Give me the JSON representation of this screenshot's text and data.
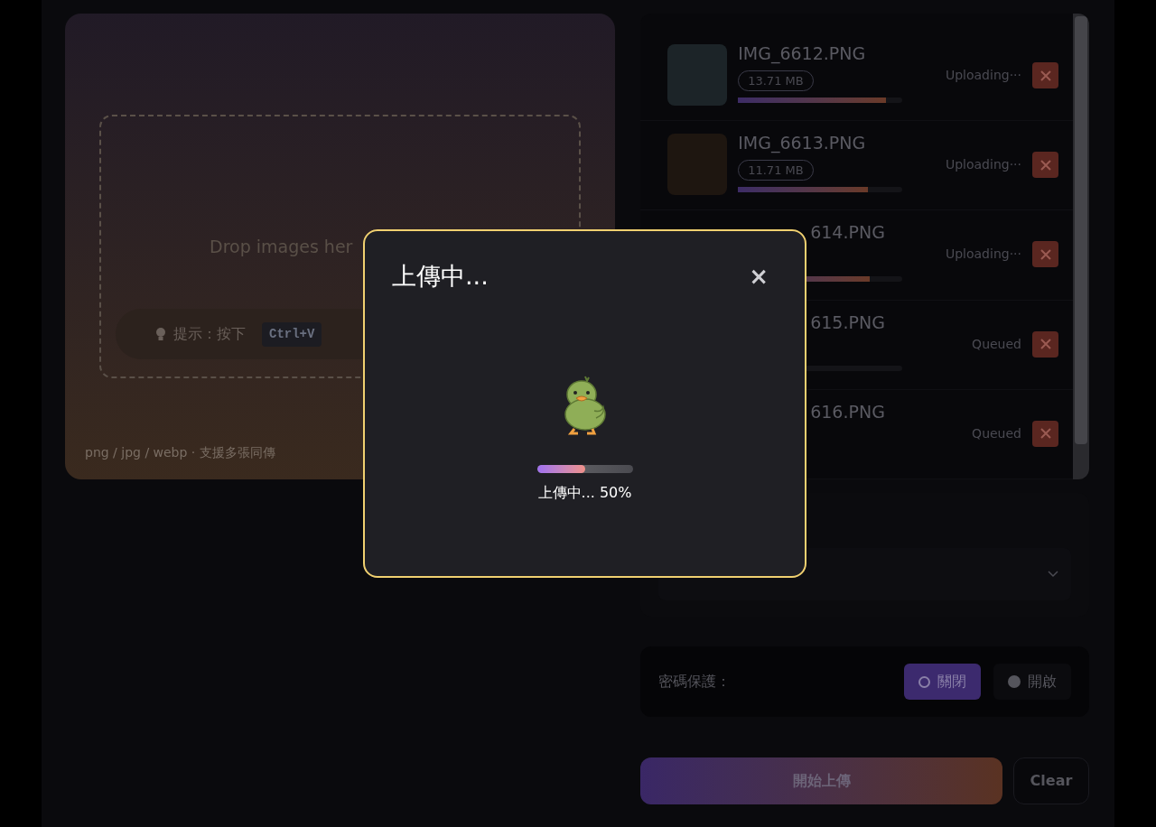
{
  "dropzone": {
    "prompt": "Drop images her",
    "hint": {
      "label": "提示：按下",
      "key": "Ctrl+V"
    },
    "formats": "png / jpg / webp · 支援多張同傳"
  },
  "files": [
    {
      "name": "IMG_6612.PNG",
      "size": "13.71 MB",
      "level": 0.9,
      "status": "Uploading···",
      "thumb": true
    },
    {
      "name": "IMG_6613.PNG",
      "size": "11.71 MB",
      "level": 0.79,
      "status": "Uploading···",
      "thumb": true
    },
    {
      "name": "614.PNG",
      "level": 0.8,
      "status": "Uploading···",
      "thumb": false
    },
    {
      "name": "615.PNG",
      "level": 0,
      "status": "Queued",
      "thumb": false
    },
    {
      "name": "616.PNG",
      "status": "Queued",
      "thumb": false
    }
  ],
  "password": {
    "label": "密碼保護：",
    "options": [
      {
        "label": "關閉",
        "selected": true
      },
      {
        "label": "開啟",
        "selected": false
      }
    ]
  },
  "actions": {
    "start": "開始上傳",
    "clear": "Clear"
  },
  "modal": {
    "title": "上傳中...",
    "close": "×",
    "level": 0.5,
    "progress_text": "上傳中... 50%"
  }
}
